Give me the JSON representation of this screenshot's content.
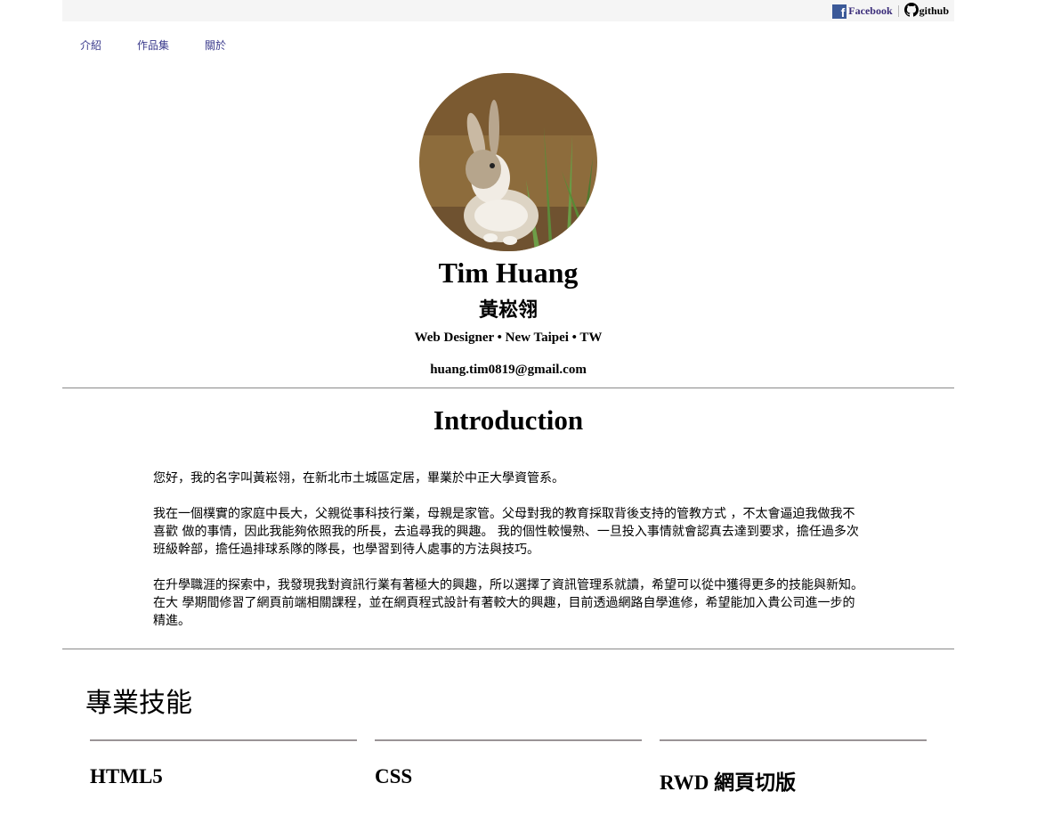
{
  "topbar": {
    "facebook": {
      "icon": "facebook-icon",
      "label": "Facebook",
      "color": "#3b5998"
    },
    "github": {
      "icon": "github-icon",
      "label": "github"
    }
  },
  "nav": {
    "items": [
      {
        "label": "介紹"
      },
      {
        "label": "作品集"
      },
      {
        "label": "關於"
      }
    ]
  },
  "profile": {
    "name": "Tim Huang",
    "chinese_name": "黃崧翎",
    "role_line": "Web Designer • New Taipei • TW",
    "email": "huang.tim0819@gmail.com"
  },
  "intro": {
    "title": "Introduction",
    "paragraphs": [
      "您好，我的名字叫黃崧翎，在新北市土城區定居，畢業於中正大學資管系。",
      "我在一個樸實的家庭中長大，父親從事科技行業，母親是家管。父母對我的教育採取背後支持的管教方式 ，不太會逼迫我做我不喜歡 做的事情，因此我能夠依照我的所長，去追尋我的興趣。 我的個性較慢熟、一旦投入事情就會認真去達到要求，擔任過多次班級幹部，擔任過排球系隊的隊長，也學習到待人處事的方法與技巧。",
      "在升學職涯的探索中，我發現我對資訊行業有著極大的興趣，所以選擇了資訊管理系就讀，希望可以從中獲得更多的技能與新知。在大 學期間修習了網頁前端相關課程，並在網頁程式設計有著較大的興趣，目前透過網路自學進修，希望能加入貴公司進一步的精進。"
    ]
  },
  "skills": {
    "title": "專業技能",
    "items": [
      {
        "name": "HTML5"
      },
      {
        "name": "CSS"
      },
      {
        "name": "RWD 網頁切版"
      }
    ]
  }
}
